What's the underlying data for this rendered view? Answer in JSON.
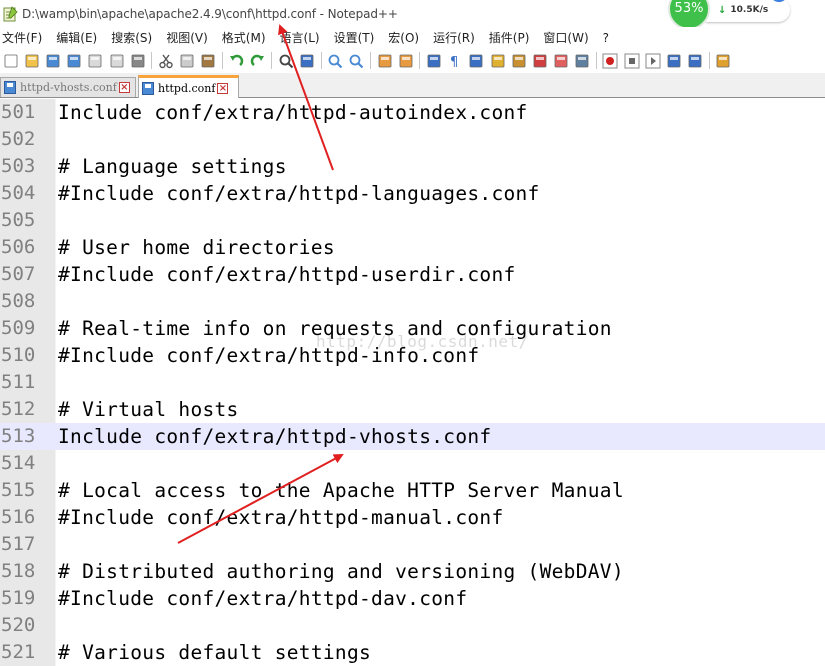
{
  "window": {
    "title": "D:\\wamp\\bin\\apache\\apache2.4.9\\conf\\httpd.conf - Notepad++"
  },
  "net_widget": {
    "percent": "53%",
    "speed": "10.5K/s",
    "arrow": "↓",
    "plus": "+"
  },
  "menu": [
    {
      "label": "文件(F)"
    },
    {
      "label": "编辑(E)"
    },
    {
      "label": "搜索(S)"
    },
    {
      "label": "视图(V)"
    },
    {
      "label": "格式(M)"
    },
    {
      "label": "语言(L)"
    },
    {
      "label": "设置(T)"
    },
    {
      "label": "宏(O)"
    },
    {
      "label": "运行(R)"
    },
    {
      "label": "插件(P)"
    },
    {
      "label": "窗口(W)"
    },
    {
      "label": "?"
    }
  ],
  "toolbar": {
    "icons": [
      "new-file-icon",
      "open-file-icon",
      "save-icon",
      "save-all-icon",
      "close-icon",
      "close-all-icon",
      "print-icon",
      "|",
      "cut-icon",
      "copy-icon",
      "paste-icon",
      "|",
      "undo-icon",
      "redo-icon",
      "|",
      "find-icon",
      "replace-icon",
      "|",
      "zoom-in-icon",
      "zoom-out-icon",
      "|",
      "sync-vertical-icon",
      "sync-horizontal-icon",
      "|",
      "word-wrap-icon",
      "show-all-chars-icon",
      "indent-guide-icon",
      "user-language-icon",
      "doc-map-icon",
      "function-list-icon",
      "folder-workspace-icon",
      "monitoring-icon",
      "|",
      "record-macro-icon",
      "stop-macro-icon",
      "play-macro-icon",
      "run-macro-multiple-icon",
      "save-macro-icon",
      "|",
      "spell-check-icon"
    ]
  },
  "tabs": [
    {
      "label": "httpd-vhosts.conf",
      "active": false
    },
    {
      "label": "httpd.conf",
      "active": true
    }
  ],
  "editor": {
    "current_line": "513",
    "watermark": "http://blog.csdn.net/",
    "lines": [
      {
        "num": "501",
        "text": "Include conf/extra/httpd-autoindex.conf"
      },
      {
        "num": "502",
        "text": ""
      },
      {
        "num": "503",
        "text": "# Language settings"
      },
      {
        "num": "504",
        "text": "#Include conf/extra/httpd-languages.conf"
      },
      {
        "num": "505",
        "text": ""
      },
      {
        "num": "506",
        "text": "# User home directories"
      },
      {
        "num": "507",
        "text": "#Include conf/extra/httpd-userdir.conf"
      },
      {
        "num": "508",
        "text": ""
      },
      {
        "num": "509",
        "text": "# Real-time info on requests and configuration"
      },
      {
        "num": "510",
        "text": "#Include conf/extra/httpd-info.conf"
      },
      {
        "num": "511",
        "text": ""
      },
      {
        "num": "512",
        "text": "# Virtual hosts"
      },
      {
        "num": "513",
        "text": "Include conf/extra/httpd-vhosts.conf"
      },
      {
        "num": "514",
        "text": ""
      },
      {
        "num": "515",
        "text": "# Local access to the Apache HTTP Server Manual"
      },
      {
        "num": "516",
        "text": "#Include conf/extra/httpd-manual.conf"
      },
      {
        "num": "517",
        "text": ""
      },
      {
        "num": "518",
        "text": "# Distributed authoring and versioning (WebDAV)"
      },
      {
        "num": "519",
        "text": "#Include conf/extra/httpd-dav.conf"
      },
      {
        "num": "520",
        "text": ""
      },
      {
        "num": "521",
        "text": "# Various default settings"
      }
    ]
  },
  "colors": {
    "annotation_arrow": "#e02020",
    "current_line_bg": "#e8e8ff",
    "gutter_bg": "#e8e8e8",
    "active_tab_accent": "#f9a43a"
  }
}
